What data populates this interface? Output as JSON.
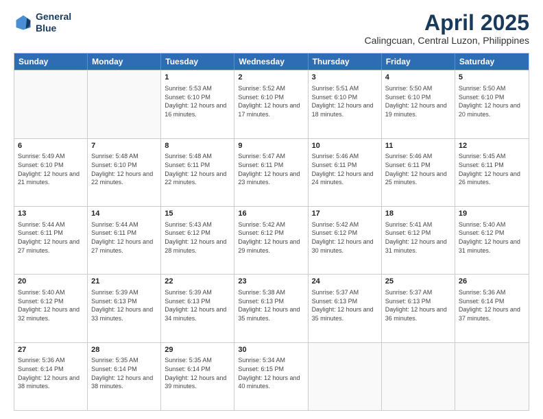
{
  "logo": {
    "line1": "General",
    "line2": "Blue"
  },
  "title": "April 2025",
  "location": "Calingcuan, Central Luzon, Philippines",
  "days_of_week": [
    "Sunday",
    "Monday",
    "Tuesday",
    "Wednesday",
    "Thursday",
    "Friday",
    "Saturday"
  ],
  "weeks": [
    [
      {
        "day": "",
        "sunrise": "",
        "sunset": "",
        "daylight": ""
      },
      {
        "day": "",
        "sunrise": "",
        "sunset": "",
        "daylight": ""
      },
      {
        "day": "1",
        "sunrise": "Sunrise: 5:53 AM",
        "sunset": "Sunset: 6:10 PM",
        "daylight": "Daylight: 12 hours and 16 minutes."
      },
      {
        "day": "2",
        "sunrise": "Sunrise: 5:52 AM",
        "sunset": "Sunset: 6:10 PM",
        "daylight": "Daylight: 12 hours and 17 minutes."
      },
      {
        "day": "3",
        "sunrise": "Sunrise: 5:51 AM",
        "sunset": "Sunset: 6:10 PM",
        "daylight": "Daylight: 12 hours and 18 minutes."
      },
      {
        "day": "4",
        "sunrise": "Sunrise: 5:50 AM",
        "sunset": "Sunset: 6:10 PM",
        "daylight": "Daylight: 12 hours and 19 minutes."
      },
      {
        "day": "5",
        "sunrise": "Sunrise: 5:50 AM",
        "sunset": "Sunset: 6:10 PM",
        "daylight": "Daylight: 12 hours and 20 minutes."
      }
    ],
    [
      {
        "day": "6",
        "sunrise": "Sunrise: 5:49 AM",
        "sunset": "Sunset: 6:10 PM",
        "daylight": "Daylight: 12 hours and 21 minutes."
      },
      {
        "day": "7",
        "sunrise": "Sunrise: 5:48 AM",
        "sunset": "Sunset: 6:10 PM",
        "daylight": "Daylight: 12 hours and 22 minutes."
      },
      {
        "day": "8",
        "sunrise": "Sunrise: 5:48 AM",
        "sunset": "Sunset: 6:11 PM",
        "daylight": "Daylight: 12 hours and 22 minutes."
      },
      {
        "day": "9",
        "sunrise": "Sunrise: 5:47 AM",
        "sunset": "Sunset: 6:11 PM",
        "daylight": "Daylight: 12 hours and 23 minutes."
      },
      {
        "day": "10",
        "sunrise": "Sunrise: 5:46 AM",
        "sunset": "Sunset: 6:11 PM",
        "daylight": "Daylight: 12 hours and 24 minutes."
      },
      {
        "day": "11",
        "sunrise": "Sunrise: 5:46 AM",
        "sunset": "Sunset: 6:11 PM",
        "daylight": "Daylight: 12 hours and 25 minutes."
      },
      {
        "day": "12",
        "sunrise": "Sunrise: 5:45 AM",
        "sunset": "Sunset: 6:11 PM",
        "daylight": "Daylight: 12 hours and 26 minutes."
      }
    ],
    [
      {
        "day": "13",
        "sunrise": "Sunrise: 5:44 AM",
        "sunset": "Sunset: 6:11 PM",
        "daylight": "Daylight: 12 hours and 27 minutes."
      },
      {
        "day": "14",
        "sunrise": "Sunrise: 5:44 AM",
        "sunset": "Sunset: 6:11 PM",
        "daylight": "Daylight: 12 hours and 27 minutes."
      },
      {
        "day": "15",
        "sunrise": "Sunrise: 5:43 AM",
        "sunset": "Sunset: 6:12 PM",
        "daylight": "Daylight: 12 hours and 28 minutes."
      },
      {
        "day": "16",
        "sunrise": "Sunrise: 5:42 AM",
        "sunset": "Sunset: 6:12 PM",
        "daylight": "Daylight: 12 hours and 29 minutes."
      },
      {
        "day": "17",
        "sunrise": "Sunrise: 5:42 AM",
        "sunset": "Sunset: 6:12 PM",
        "daylight": "Daylight: 12 hours and 30 minutes."
      },
      {
        "day": "18",
        "sunrise": "Sunrise: 5:41 AM",
        "sunset": "Sunset: 6:12 PM",
        "daylight": "Daylight: 12 hours and 31 minutes."
      },
      {
        "day": "19",
        "sunrise": "Sunrise: 5:40 AM",
        "sunset": "Sunset: 6:12 PM",
        "daylight": "Daylight: 12 hours and 31 minutes."
      }
    ],
    [
      {
        "day": "20",
        "sunrise": "Sunrise: 5:40 AM",
        "sunset": "Sunset: 6:12 PM",
        "daylight": "Daylight: 12 hours and 32 minutes."
      },
      {
        "day": "21",
        "sunrise": "Sunrise: 5:39 AM",
        "sunset": "Sunset: 6:13 PM",
        "daylight": "Daylight: 12 hours and 33 minutes."
      },
      {
        "day": "22",
        "sunrise": "Sunrise: 5:39 AM",
        "sunset": "Sunset: 6:13 PM",
        "daylight": "Daylight: 12 hours and 34 minutes."
      },
      {
        "day": "23",
        "sunrise": "Sunrise: 5:38 AM",
        "sunset": "Sunset: 6:13 PM",
        "daylight": "Daylight: 12 hours and 35 minutes."
      },
      {
        "day": "24",
        "sunrise": "Sunrise: 5:37 AM",
        "sunset": "Sunset: 6:13 PM",
        "daylight": "Daylight: 12 hours and 35 minutes."
      },
      {
        "day": "25",
        "sunrise": "Sunrise: 5:37 AM",
        "sunset": "Sunset: 6:13 PM",
        "daylight": "Daylight: 12 hours and 36 minutes."
      },
      {
        "day": "26",
        "sunrise": "Sunrise: 5:36 AM",
        "sunset": "Sunset: 6:14 PM",
        "daylight": "Daylight: 12 hours and 37 minutes."
      }
    ],
    [
      {
        "day": "27",
        "sunrise": "Sunrise: 5:36 AM",
        "sunset": "Sunset: 6:14 PM",
        "daylight": "Daylight: 12 hours and 38 minutes."
      },
      {
        "day": "28",
        "sunrise": "Sunrise: 5:35 AM",
        "sunset": "Sunset: 6:14 PM",
        "daylight": "Daylight: 12 hours and 38 minutes."
      },
      {
        "day": "29",
        "sunrise": "Sunrise: 5:35 AM",
        "sunset": "Sunset: 6:14 PM",
        "daylight": "Daylight: 12 hours and 39 minutes."
      },
      {
        "day": "30",
        "sunrise": "Sunrise: 5:34 AM",
        "sunset": "Sunset: 6:15 PM",
        "daylight": "Daylight: 12 hours and 40 minutes."
      },
      {
        "day": "",
        "sunrise": "",
        "sunset": "",
        "daylight": ""
      },
      {
        "day": "",
        "sunrise": "",
        "sunset": "",
        "daylight": ""
      },
      {
        "day": "",
        "sunrise": "",
        "sunset": "",
        "daylight": ""
      }
    ]
  ]
}
